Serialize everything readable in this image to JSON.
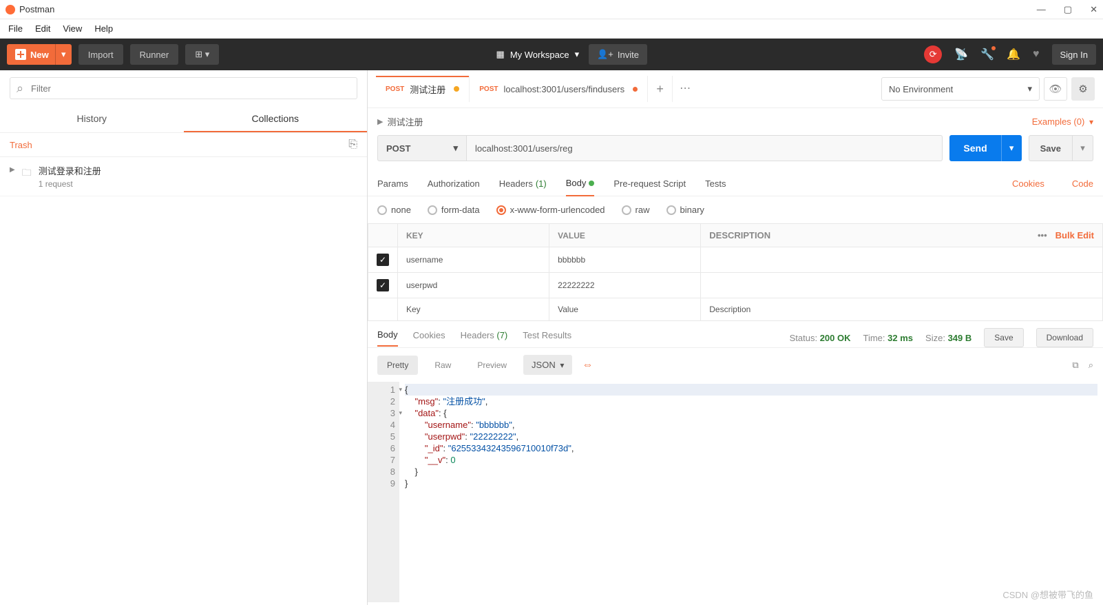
{
  "app": {
    "name": "Postman"
  },
  "menu": {
    "file": "File",
    "edit": "Edit",
    "view": "View",
    "help": "Help"
  },
  "toolbar": {
    "new": "New",
    "import": "Import",
    "runner": "Runner",
    "workspace": "My Workspace",
    "invite": "Invite",
    "signin": "Sign In"
  },
  "sidebar": {
    "filter_placeholder": "Filter",
    "tab_history": "History",
    "tab_collections": "Collections",
    "trash": "Trash",
    "collection": {
      "name": "测试登录和注册",
      "sub": "1 request"
    }
  },
  "tabs": {
    "t1": {
      "method": "POST",
      "title": "测试注册"
    },
    "t2": {
      "method": "POST",
      "title": "localhost:3001/users/findusers"
    }
  },
  "env": {
    "selected": "No Environment"
  },
  "request": {
    "name": "测试注册",
    "examples": "Examples (0)",
    "method": "POST",
    "url": "localhost:3001/users/reg",
    "send": "Send",
    "save": "Save",
    "tabs": {
      "params": "Params",
      "auth": "Authorization",
      "headers": "Headers",
      "headers_count": "(1)",
      "body": "Body",
      "prereq": "Pre-request Script",
      "tests": "Tests",
      "cookies": "Cookies",
      "code": "Code"
    },
    "body_types": {
      "none": "none",
      "form": "form-data",
      "url": "x-www-form-urlencoded",
      "raw": "raw",
      "binary": "binary"
    },
    "table": {
      "h_key": "KEY",
      "h_value": "VALUE",
      "h_desc": "DESCRIPTION",
      "bulk": "Bulk Edit",
      "rows": [
        {
          "key": "username",
          "value": "bbbbbb"
        },
        {
          "key": "userpwd",
          "value": "22222222"
        }
      ],
      "ph_key": "Key",
      "ph_value": "Value",
      "ph_desc": "Description"
    }
  },
  "response": {
    "tabs": {
      "body": "Body",
      "cookies": "Cookies",
      "headers": "Headers",
      "headers_count": "(7)",
      "tests": "Test Results"
    },
    "status_label": "Status:",
    "status": "200 OK",
    "time_label": "Time:",
    "time": "32 ms",
    "size_label": "Size:",
    "size": "349 B",
    "save": "Save",
    "download": "Download",
    "pretty": "Pretty",
    "raw": "Raw",
    "preview": "Preview",
    "format": "JSON",
    "json": {
      "msg": "注册成功",
      "data": {
        "username": "bbbbbb",
        "userpwd": "22222222",
        "_id": "62553343243596710010f73d",
        "__v": 0
      }
    }
  },
  "watermark": "CSDN @想被带飞的鱼"
}
